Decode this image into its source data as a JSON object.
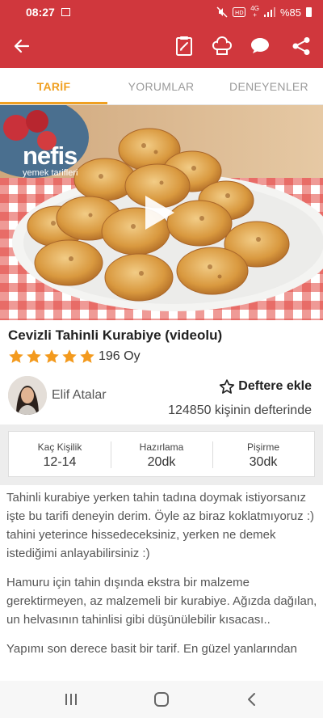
{
  "status_bar": {
    "time": "08:27",
    "net_top": "4G",
    "net_bottom": "+",
    "battery": "%85",
    "icons": [
      "gallery-icon",
      "mute-icon",
      "hd-icon",
      "signal-icon",
      "battery-icon"
    ]
  },
  "app_bar": {
    "background": "#d0373d",
    "icons": [
      "back-arrow-icon",
      "shopping-list-icon",
      "chef-hat-icon",
      "comment-icon",
      "share-icon"
    ]
  },
  "tabs": [
    {
      "label": "TARİF",
      "active": true
    },
    {
      "label": "YORUMLAR",
      "active": false
    },
    {
      "label": "DENEYENLER",
      "active": false
    }
  ],
  "hero": {
    "logo_main": "nefis",
    "logo_sub": "yemek tarifleri",
    "icons": [
      "play-icon"
    ]
  },
  "recipe": {
    "title": "Cevizli Tahinli Kurabiye (videolu)",
    "rating_stars": 5,
    "votes": "196 Oy"
  },
  "author": {
    "name": "Elif Atalar"
  },
  "notebook": {
    "label": "Deftere ekle",
    "count_text": "124850 kişinin defterinde"
  },
  "info": [
    {
      "label": "Kaç Kişilik",
      "value": "12-14"
    },
    {
      "label": "Hazırlama",
      "value": "20dk"
    },
    {
      "label": "Pişirme",
      "value": "30dk"
    }
  ],
  "description": [
    "Tahinli kurabiye yerken tahin tadına doymak istiyorsanız işte bu tarifi deneyin derim. Öyle az biraz koklatmıyoruz :) tahini yeterince hissedeceksiniz, yerken ne demek istediğimi anlayabilirsiniz :)",
    "Hamuru için tahin dışında ekstra bir malzeme gerektirmeyen, az malzemeli bir kurabiye. Ağızda dağılan, un helvasının tahinlisi gibi düşünülebilir kısacası..",
    "Yapımı son derece basit bir tarif. En güzel yanlarından"
  ],
  "colors": {
    "brand_red": "#d0373d",
    "accent_orange": "#f0a021",
    "star_orange": "#f39a1e"
  },
  "nav_bar": {
    "icons": [
      "recent-apps-icon",
      "home-icon",
      "back-icon"
    ]
  }
}
